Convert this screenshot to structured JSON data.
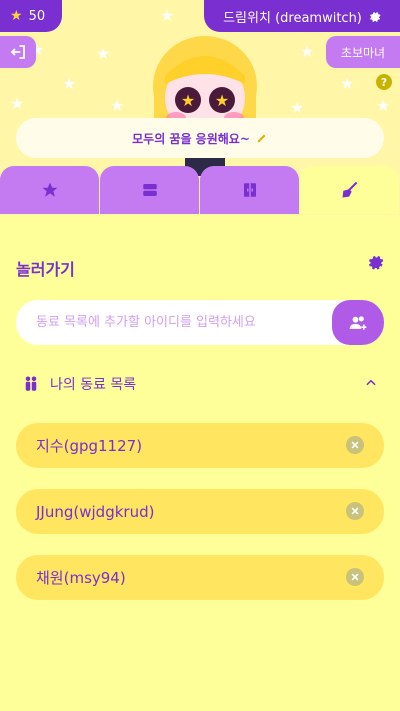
{
  "header": {
    "coins": "50",
    "username": "드림위치 (dreamwitch)",
    "rank": "초보마녀",
    "help": "?",
    "status_message": "모두의 꿈을 응원해요~"
  },
  "tabs": [
    {
      "icon": "star-icon"
    },
    {
      "icon": "card-icon"
    },
    {
      "icon": "closet-icon"
    },
    {
      "icon": "broom-icon"
    }
  ],
  "main": {
    "section_title": "놀러가기",
    "search": {
      "placeholder": "동료 목록에 추가할 아이디를 입력하세요",
      "value": ""
    },
    "list_title": "나의 동료 목록",
    "friends": [
      "지수(gpg1127)",
      "JJung(wjdgkrud)",
      "채원(msy94)"
    ]
  },
  "colors": {
    "accent": "#7a2fd0",
    "secondary": "#c47af0",
    "background": "#ffff99",
    "friend_row": "#ffe560"
  }
}
